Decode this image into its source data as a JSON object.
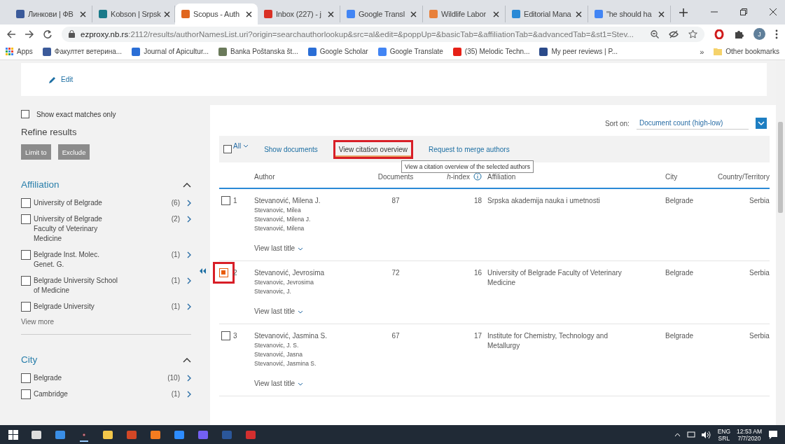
{
  "browser": {
    "tabs": [
      {
        "title": "Линкови | ФВ",
        "selected": false
      },
      {
        "title": "Kobson | Srpsk",
        "selected": false
      },
      {
        "title": "Scopus - Auth",
        "selected": true
      },
      {
        "title": "Inbox (227) - j",
        "selected": false
      },
      {
        "title": "Google Transl",
        "selected": false
      },
      {
        "title": "Wildlife Labor",
        "selected": false
      },
      {
        "title": "Editorial Mana",
        "selected": false
      },
      {
        "title": "\"he should ha",
        "selected": false
      }
    ],
    "url_host": "ezproxy.nb.rs",
    "url_rest": ":2112/results/authorNamesList.uri?origin=searchauthorlookup&src=al&edit=&poppUp=&basicTab=&affiliationTab=&advancedTab=&st1=Stev...",
    "profile_initial": "J",
    "apps_label": "Apps",
    "bookmarks": [
      "Факултет ветерина...",
      "Journal of Apicultur...",
      "Banka Poštanska št...",
      "Google Scholar",
      "Google Translate",
      "(35) Melodic Techn...",
      "My peer reviews | P..."
    ],
    "more_bookmarks": "»",
    "other_bookmarks": "Other bookmarks"
  },
  "page": {
    "edit_label": "Edit",
    "exact_matches": {
      "label": "Show exact matches only",
      "checked": false
    },
    "refine_title": "Refine results",
    "refine_buttons": [
      {
        "label": "Limit to",
        "disabled": true
      },
      {
        "label": "Exclude",
        "disabled": true
      }
    ],
    "facets": [
      {
        "title": "Affiliation",
        "expanded": true,
        "items": [
          {
            "label": "University of Belgrade",
            "count": "(6)",
            "checked": false
          },
          {
            "label": "University of Belgrade Faculty of Veterinary Medicine",
            "count": "(2)",
            "checked": false
          },
          {
            "label": "Belgrade Inst. Molec. Genet. G.",
            "count": "(1)",
            "checked": false
          },
          {
            "label": "Belgrade University School of Medicine",
            "count": "(1)",
            "checked": false
          },
          {
            "label": "Belgrade University",
            "count": "(1)",
            "checked": false
          }
        ],
        "view_more": "View more"
      },
      {
        "title": "City",
        "expanded": true,
        "items": [
          {
            "label": "Belgrade",
            "count": "(10)",
            "checked": false
          },
          {
            "label": "Cambridge",
            "count": "(1)",
            "checked": false
          }
        ]
      }
    ],
    "results": {
      "sort_label": "Sort on:",
      "sort_value": "Document count (high-low)",
      "select_all": {
        "label": "All",
        "checked": false
      },
      "actions": [
        {
          "label": "Show documents",
          "highlighted": false
        },
        {
          "label": "View citation overview",
          "highlighted": true
        },
        {
          "label": "Request to merge authors",
          "highlighted": false
        }
      ],
      "tooltip": "View a citation overview of the selected authors",
      "columns": [
        "Author",
        "Documents",
        "*h*-index",
        "Affiliation",
        "City",
        "Country/Territory"
      ],
      "rows": [
        {
          "number": "1",
          "checked": false,
          "highlighted": false,
          "names": [
            "Stevanović, Milena J.",
            "Stevanovic, Milea",
            "Stevanović, Milena J.",
            "Stevanović, Milena"
          ],
          "documents": "87",
          "h_index": "18",
          "affiliation": "Srpska akademija nauka i umetnosti",
          "city": "Belgrade",
          "country": "Serbia",
          "view_last_title": "View last title"
        },
        {
          "number": "2",
          "checked": true,
          "highlighted": true,
          "names": [
            "Stevanović, Jevrosima",
            "Stevanovic, Jevrosima",
            "Stevanovic, J."
          ],
          "documents": "72",
          "h_index": "16",
          "affiliation": "University of Belgrade Faculty of Veterinary Medicine",
          "city": "Belgrade",
          "country": "Serbia",
          "view_last_title": "View last title"
        },
        {
          "number": "3",
          "checked": false,
          "highlighted": false,
          "names": [
            "Stevanović, Jasmina S.",
            "Stevanovic, J. S.",
            "Stevanović, Jasna",
            "Stevanović, Jasmina S."
          ],
          "documents": "67",
          "h_index": "17",
          "affiliation": "Institute for Chemistry, Technology and Metallurgy",
          "city": "Belgrade",
          "country": "Serbia",
          "view_last_title": "View last title"
        }
      ]
    }
  },
  "taskbar": {
    "language": "ENG",
    "layout": "SRL",
    "time": "12:53 AM",
    "date": "7/7/2020"
  }
}
